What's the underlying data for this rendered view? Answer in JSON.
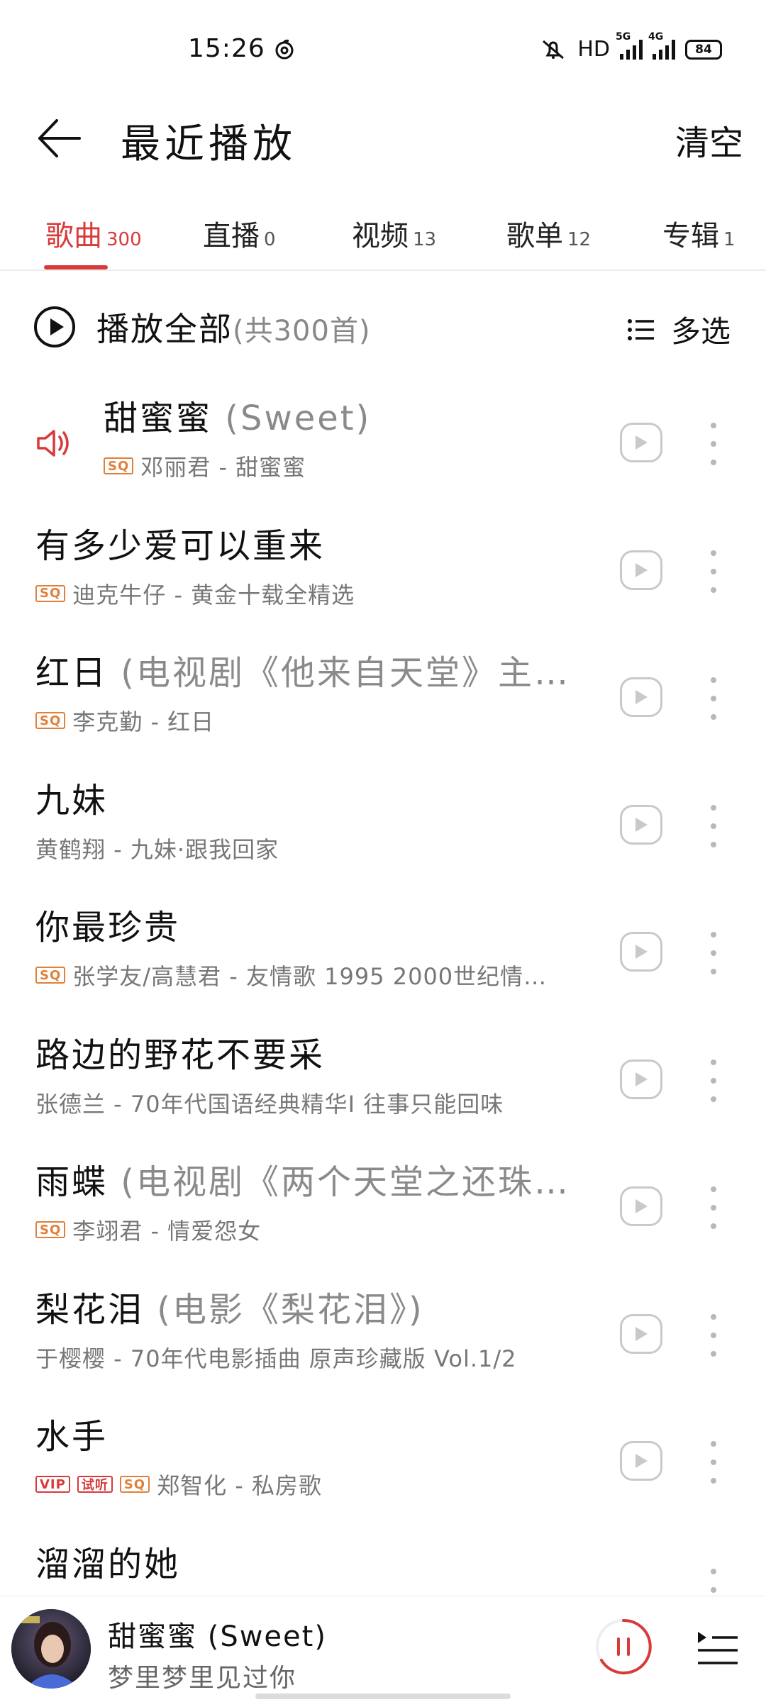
{
  "status_bar": {
    "time": "15:26",
    "hd_label": "HD",
    "net1": "5G",
    "net2": "4G",
    "battery": "84"
  },
  "header": {
    "title": "最近播放",
    "clear_label": "清空"
  },
  "tabs": [
    {
      "label": "歌曲",
      "count": "300",
      "active": true
    },
    {
      "label": "直播",
      "count": "0",
      "active": false
    },
    {
      "label": "视频",
      "count": "13",
      "active": false
    },
    {
      "label": "歌单",
      "count": "12",
      "active": false
    },
    {
      "label": "专辑",
      "count": "1",
      "active": false
    }
  ],
  "play_all": {
    "label": "播放全部",
    "count_text": "(共300首)",
    "multi_select": "多选"
  },
  "songs": [
    {
      "title": "甜蜜蜜",
      "extra": " (Sweet)",
      "artist_album": "邓丽君 - 甜蜜蜜",
      "badges": [
        "SQ"
      ],
      "playing": true
    },
    {
      "title": "有多少爱可以重来",
      "extra": "",
      "artist_album": "迪克牛仔 - 黄金十载全精选",
      "badges": [
        "SQ"
      ],
      "playing": false
    },
    {
      "title": "红日",
      "extra": " (电视剧《他来自天堂》主…",
      "artist_album": "李克勤 - 红日",
      "badges": [
        "SQ"
      ],
      "playing": false
    },
    {
      "title": "九妹",
      "extra": "",
      "artist_album": "黄鹤翔 - 九妹·跟我回家",
      "badges": [],
      "playing": false
    },
    {
      "title": "你最珍贵",
      "extra": "",
      "artist_album": "张学友/高慧君 - 友情歌 1995 2000世纪情…",
      "badges": [
        "SQ"
      ],
      "playing": false
    },
    {
      "title": "路边的野花不要采",
      "extra": "",
      "artist_album": "张德兰 - 70年代国语经典精华I 往事只能回味",
      "badges": [],
      "playing": false
    },
    {
      "title": "雨蝶",
      "extra": " (电视剧《两个天堂之还珠…",
      "artist_album": "李翊君 - 情爱怨女",
      "badges": [
        "SQ"
      ],
      "playing": false
    },
    {
      "title": "梨花泪",
      "extra": " (电影《梨花泪》)",
      "artist_album": "于樱樱 - 70年代电影插曲 原声珍藏版 Vol.1/2",
      "badges": [],
      "playing": false
    },
    {
      "title": "水手",
      "extra": "",
      "artist_album": "郑智化 - 私房歌",
      "badges": [
        "VIP",
        "试听",
        "SQ"
      ],
      "playing": false
    },
    {
      "title": "溜溜的她",
      "extra": "",
      "artist_album": "",
      "badges": [],
      "playing": false
    }
  ],
  "mini_player": {
    "song": "甜蜜蜜 (Sweet)",
    "lyric": "梦里梦里见过你"
  },
  "colors": {
    "accent": "#d83a3a",
    "sq_badge": "#e0803a"
  }
}
